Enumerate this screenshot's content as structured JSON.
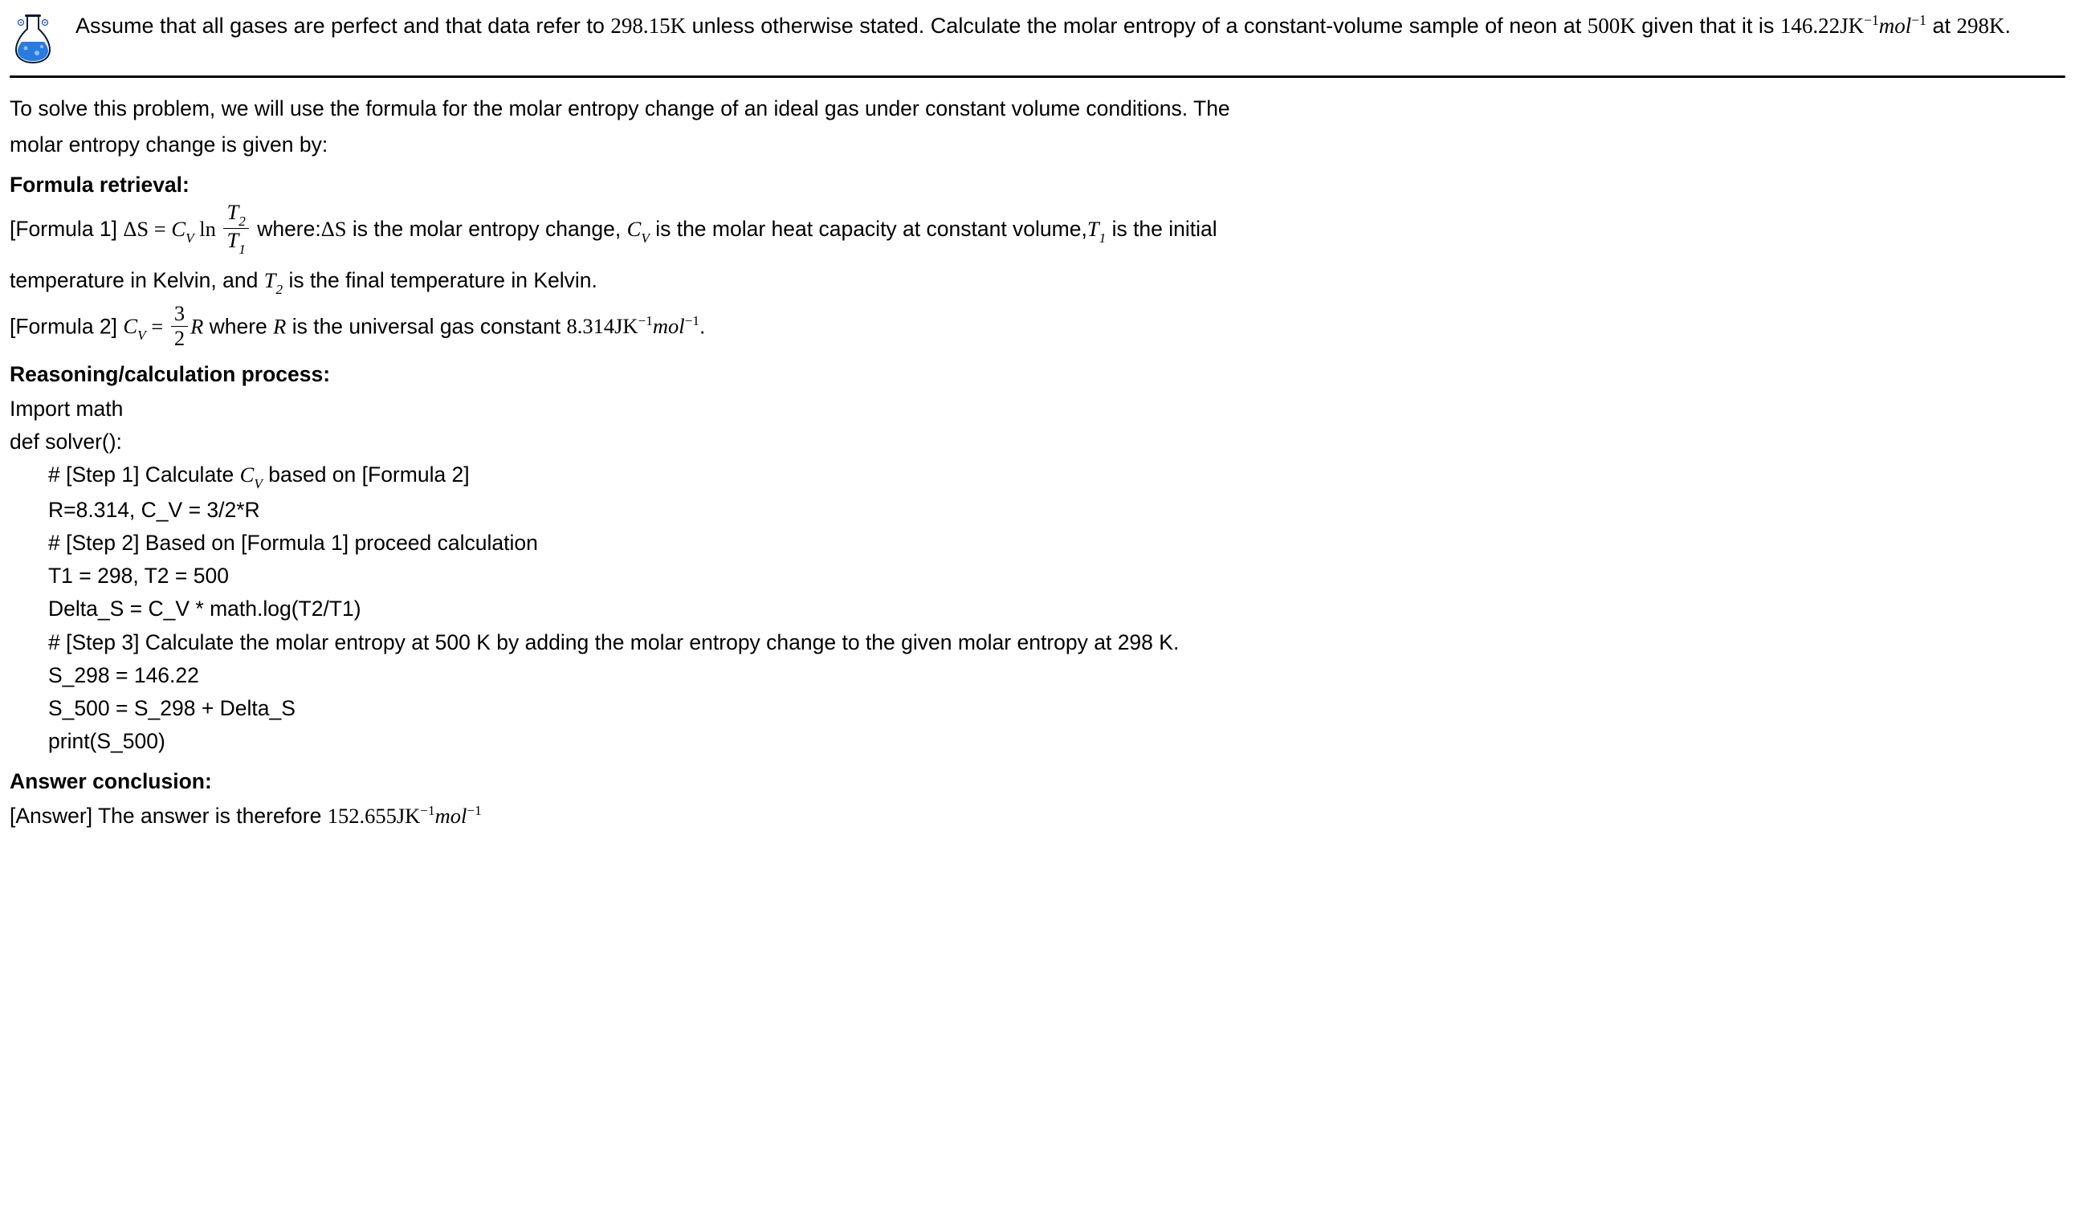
{
  "question": {
    "line1_prefix": "Assume that all gases are perfect and that data refer to ",
    "temp1": "298.15K",
    "line1_suffix": " unless otherwise stated. Calculate the molar entropy of a",
    "line2_prefix": "constant-volume sample of neon at ",
    "temp2": "500K",
    "line2_mid": " given that it is ",
    "value1": "146.22JK",
    "exp_minus1a": "−1",
    "unit_mol": "mol",
    "exp_minus1b": "−1",
    "line2_suffix": " at ",
    "temp3": "298K",
    "period": "."
  },
  "intro": {
    "line1": "To solve this problem, we will use the formula for the molar entropy change of an ideal gas under constant volume conditions. The",
    "line2": "molar entropy change is given by:"
  },
  "headings": {
    "formula_retrieval": "Formula retrieval:",
    "reasoning": "Reasoning/calculation process:",
    "answer_conclusion": "Answer conclusion:"
  },
  "formula1": {
    "label": "[Formula 1] ",
    "deltaS": "ΔS",
    "eq": " = ",
    "Cv_C": "C",
    "Cv_V": "V",
    "ln": " ln ",
    "T2_T": "T",
    "T2_2": "2",
    "T1_T": "T",
    "T1_1": "1",
    "where_prefix": " where:",
    "deltaS2": "ΔS",
    "desc1": " is the molar entropy change, ",
    "desc2": " is the molar heat capacity at constant volume,",
    "T1_label": " is the initial",
    "line2_prefix": "temperature in Kelvin, and ",
    "line2_suffix": " is the final temperature in Kelvin."
  },
  "formula2": {
    "label": "[Formula 2] ",
    "eq": " = ",
    "num": "3",
    "den": "2",
    "R": "R",
    "where": " where ",
    "R2": "R",
    "desc": " is the universal gas constant ",
    "val": "8.314JK",
    "exp1": "−1",
    "mol": "mol",
    "exp2": "−1",
    "period": "."
  },
  "code": {
    "l1": "Import math",
    "l2": "def solver():",
    "s1a": "# [Step 1] Calculate ",
    "s1b": " based on [Formula 2]",
    "s2": "R=8.314, C_V = 3/2*R",
    "s3": "# [Step 2] Based on [Formula 1] proceed calculation",
    "s4": "T1 = 298, T2 = 500",
    "s5": "Delta_S = C_V * math.log(T2/T1)",
    "s6": "# [Step 3] Calculate the molar entropy at 500 K by adding the molar entropy change to the given molar entropy at 298 K.",
    "s7": "S_298 = 146.22",
    "s8": "S_500 = S_298 + Delta_S",
    "s9": "print(S_500)"
  },
  "answer": {
    "prefix": "[Answer] The answer is therefore ",
    "val": "152.655JK",
    "exp1": "−1",
    "mol": "mol",
    "exp2": "−1"
  }
}
